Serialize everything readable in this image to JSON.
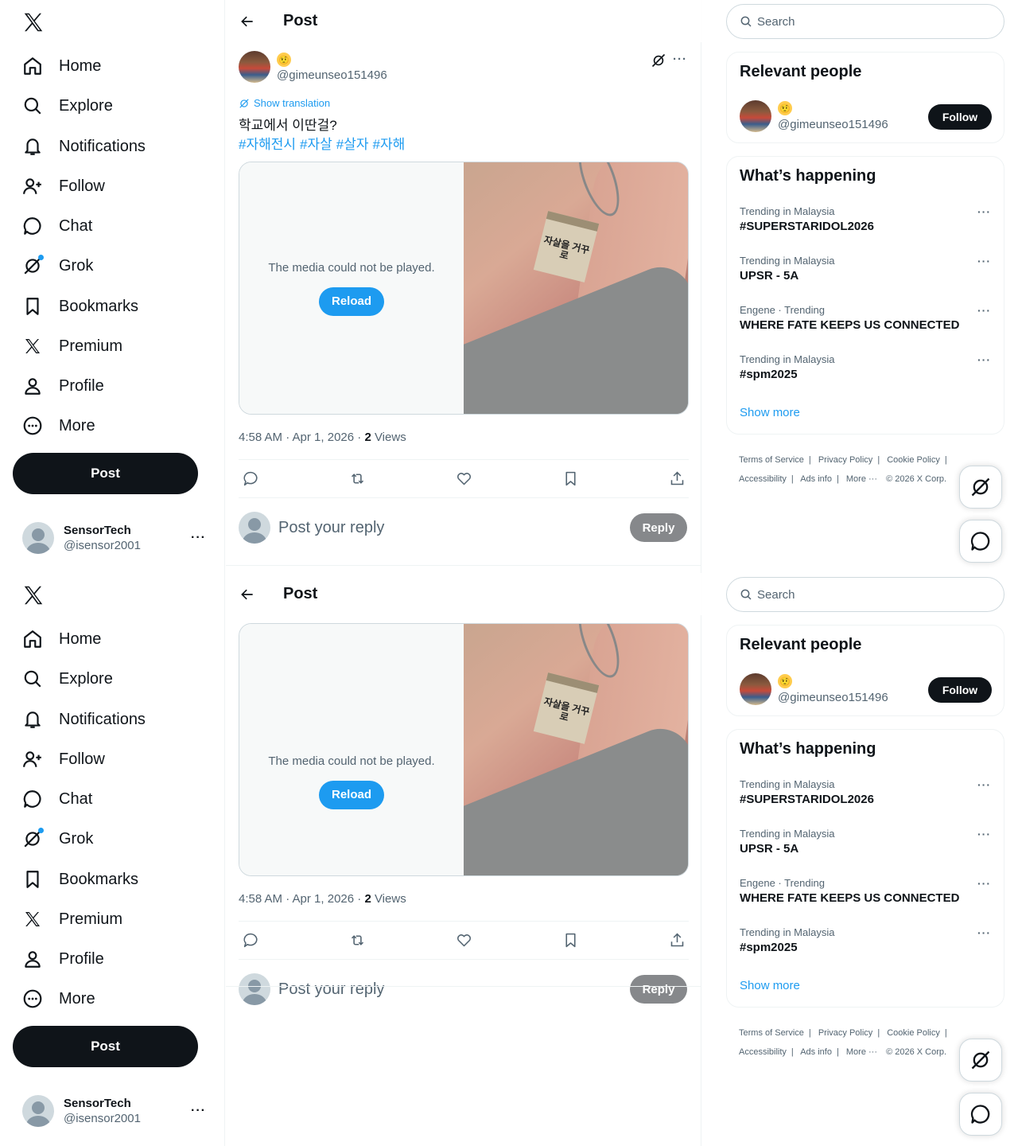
{
  "nav": {
    "items": [
      {
        "label": "Home",
        "icon": "home-icon"
      },
      {
        "label": "Explore",
        "icon": "search-icon"
      },
      {
        "label": "Notifications",
        "icon": "bell-icon"
      },
      {
        "label": "Follow",
        "icon": "add-user-icon"
      },
      {
        "label": "Chat",
        "icon": "chat-bubble-icon"
      },
      {
        "label": "Grok",
        "icon": "grok-icon"
      },
      {
        "label": "Bookmarks",
        "icon": "bookmark-icon"
      },
      {
        "label": "Premium",
        "icon": "x-logo-icon"
      },
      {
        "label": "Profile",
        "icon": "person-icon"
      },
      {
        "label": "More",
        "icon": "more-circle-icon"
      }
    ],
    "post_label": "Post",
    "account": {
      "name": "SensorTech",
      "handle": "@isensor2001",
      "more": "···"
    }
  },
  "header": {
    "title": "Post"
  },
  "tweet": {
    "emoji": "🤨",
    "handle": "@gimeunseo151496",
    "more": "···",
    "translate_label": "Show translation",
    "text": "학교에서 이딴걸?",
    "hashtags": [
      "#자해전시",
      "#자살",
      "#살자",
      "#자해"
    ],
    "media_error": "The media could not be played.",
    "reload_label": "Reload",
    "image_label_text": "자살을 거꾸로",
    "time": "4:58 AM · Apr 1, 2026 · ",
    "views_count": "2",
    "views_label": " Views",
    "reply_placeholder": "Post your reply",
    "reply_label": "Reply"
  },
  "right": {
    "search_placeholder": "Search",
    "relevant_title": "Relevant people",
    "relevant_emoji": "🤨",
    "relevant_handle": "@gimeunseo151496",
    "follow_label": "Follow",
    "happening_title": "What’s happening",
    "trends": [
      {
        "context": "Trending in Malaysia",
        "name": "#SUPERSTARIDOL2026"
      },
      {
        "context": "Trending in Malaysia",
        "name": "UPSR - 5A"
      },
      {
        "context": "Engene · Trending",
        "name": "WHERE FATE KEEPS US CONNECTED"
      },
      {
        "context": "Trending in Malaysia",
        "name": "#spm2025"
      }
    ],
    "trend_more": "···",
    "show_more": "Show more",
    "footer": {
      "terms": "Terms of Service",
      "privacy": "Privacy Policy",
      "cookie": "Cookie Policy",
      "accessibility": "Accessibility",
      "ads": "Ads info",
      "more": "More ···",
      "copyright": "© 2026 X Corp."
    }
  },
  "colors": {
    "accent": "#1d9bf0",
    "text": "#0f1419",
    "muted": "#536471",
    "border": "#eff3f4"
  }
}
